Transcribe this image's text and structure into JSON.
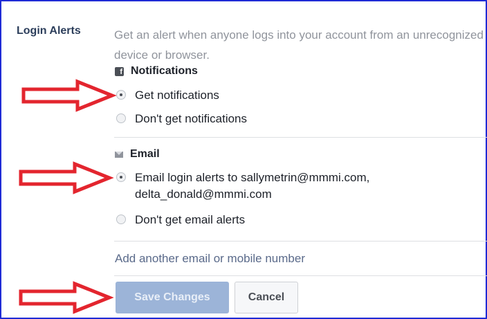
{
  "section": {
    "label": "Login Alerts",
    "description": "Get an alert when anyone logs into your account from an unrecognized device or browser."
  },
  "notifications": {
    "header": "Notifications",
    "icon": "facebook-icon",
    "options": [
      {
        "label": "Get notifications",
        "checked": true
      },
      {
        "label": "Don't get notifications",
        "checked": false
      }
    ]
  },
  "email": {
    "header": "Email",
    "icon": "envelope-icon",
    "options": [
      {
        "label_line1": "Email login alerts to sallymetrin@mmmi.com,",
        "label_line2": "delta_donald@mmmi.com",
        "checked": true
      },
      {
        "label": "Don't get email alerts",
        "checked": false
      }
    ]
  },
  "add_link": "Add another email or mobile number",
  "buttons": {
    "save": "Save Changes",
    "cancel": "Cancel"
  },
  "colors": {
    "frame_border": "#1f2bd6",
    "arrow": "#e3252e",
    "save_button": "#9cb4d8"
  }
}
